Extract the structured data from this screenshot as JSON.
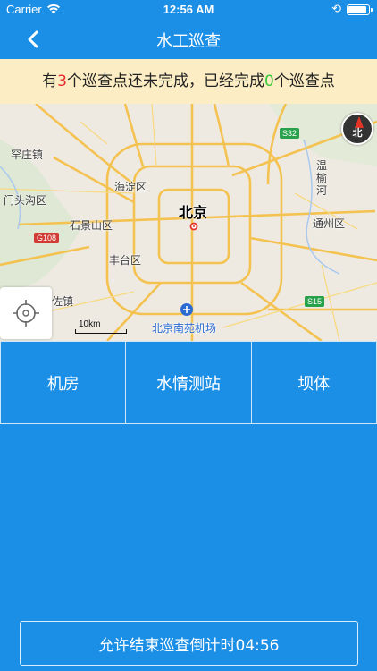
{
  "status_bar": {
    "carrier": "Carrier",
    "time": "12:56 AM"
  },
  "nav": {
    "title": "水工巡查"
  },
  "notice": {
    "prefix": "有",
    "unfinished": "3",
    "middle": "个巡查点还未完成，已经完成",
    "finished": "0",
    "suffix": "个巡查点",
    "unfinished_color": "#e8282c",
    "finished_color": "#37c83b"
  },
  "map": {
    "city": "北京",
    "labels": {
      "hdq": "海淀区",
      "mtg": "门头沟区",
      "sjs": "石景山区",
      "ftq": "丰台区",
      "tzq": "通州区",
      "hzz": "罕庄镇",
      "zgz": "佐镇",
      "wyh": "温榆河",
      "airport": "北京南苑机场"
    },
    "road_tags": {
      "s32": "S32",
      "g108": "G108",
      "s15": "S15"
    },
    "compass_label": "北",
    "scale": "10km"
  },
  "tabs": [
    "机房",
    "水情测站",
    "坝体"
  ],
  "countdown": {
    "label": "允许结束巡查倒计时04:56"
  },
  "colors": {
    "primary": "#1b8fe6",
    "notice_bg": "#fcedc4"
  }
}
